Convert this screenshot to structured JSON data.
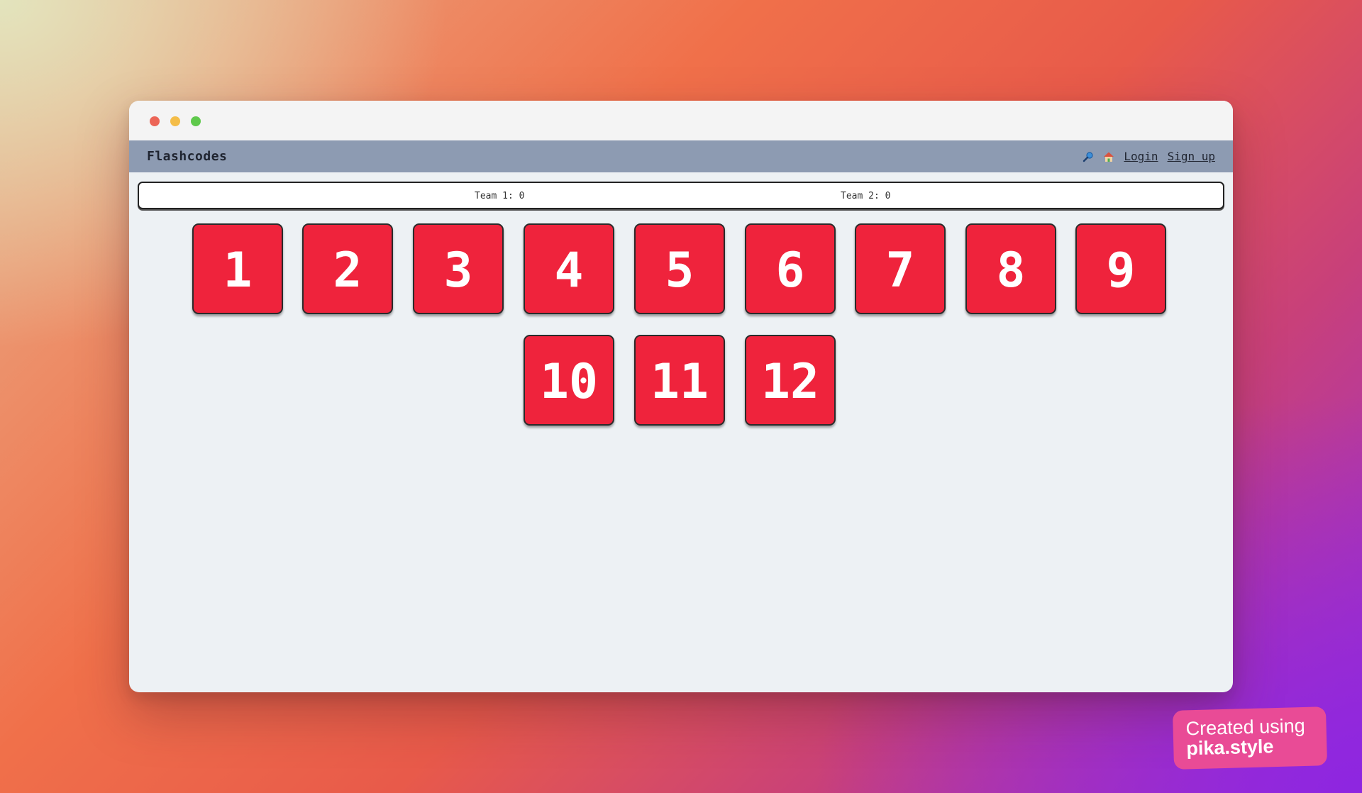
{
  "window": {
    "traffic_lights": [
      "close",
      "minimize",
      "zoom"
    ]
  },
  "navbar": {
    "brand": "Flashcodes",
    "icons": [
      "magnifying-glass-icon",
      "house-icon"
    ],
    "login_label": "Login",
    "signup_label": "Sign up"
  },
  "scoreboard": {
    "team1": "Team 1: 0",
    "team2": "Team 2: 0"
  },
  "cards": [
    "1",
    "2",
    "3",
    "4",
    "5",
    "6",
    "7",
    "8",
    "9",
    "10",
    "11",
    "12"
  ],
  "colors": {
    "card": "#ef233c",
    "navbar": "#8d9bb2",
    "page": "#edf1f4"
  },
  "badge": {
    "line1": "Created using",
    "line2": "pika.style"
  }
}
